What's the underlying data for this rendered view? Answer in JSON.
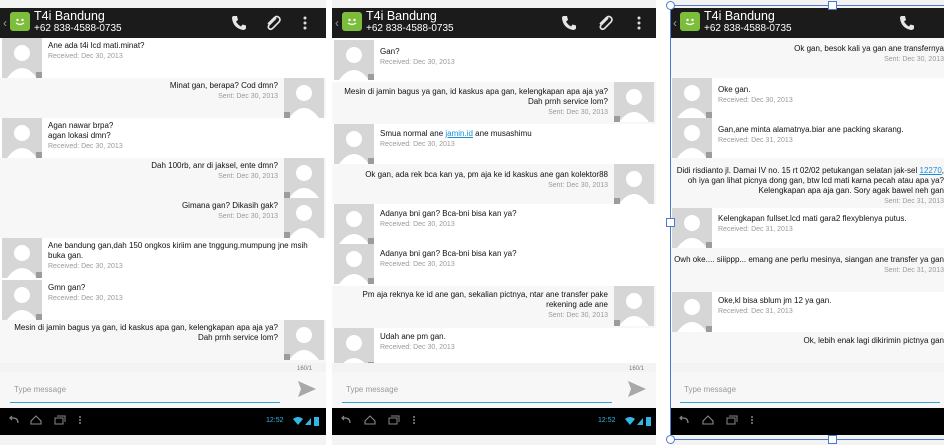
{
  "screens": [
    {
      "contact_name": "T4i Bandung",
      "contact_number": "+62 838-4588-0735",
      "counter": "160/1",
      "compose_placeholder": "Type message",
      "clock": "12:52",
      "messages": [
        {
          "dir": "in",
          "text": "Ane ada t4i lcd mati.minat?",
          "meta": "Received: Dec 30, 2013"
        },
        {
          "dir": "out",
          "text": "Minat gan, berapa? Cod dmn?",
          "meta": "Sent: Dec 30, 2013"
        },
        {
          "dir": "in",
          "text": "Agan nawar brpa?\nagan lokasi dmn?",
          "meta": "Received: Dec 30, 2013"
        },
        {
          "dir": "out",
          "text": "Dah 100rb, anr di jaksel, ente dmn?",
          "meta": "Sent: Dec 30, 2013"
        },
        {
          "dir": "out",
          "text": "Gimana gan? Dikasih gak?",
          "meta": "Sent: Dec 30, 2013"
        },
        {
          "dir": "in",
          "text": "Ane bandung gan,dah 150 ongkos kiriim ane tnggung.mumpung jne msih buka gan.",
          "meta": "Received: Dec 30, 2013"
        },
        {
          "dir": "in",
          "text": "Gmn gan?",
          "meta": "Received: Dec 30, 2013"
        },
        {
          "dir": "out",
          "text": "Mesin di jamin bagus ya gan, id kaskus apa gan, kelengkapan apa aja ya? Dah prnh service lom?",
          "meta": ""
        }
      ]
    },
    {
      "contact_name": "T4i Bandung",
      "contact_number": "+62 838-4588-0735",
      "counter": "160/1",
      "compose_placeholder": "Type message",
      "clock": "12:52",
      "messages": [
        {
          "dir": "in",
          "text": "Gan?",
          "meta": "Received: Dec 30, 2013"
        },
        {
          "dir": "out",
          "text": "Mesin di jamin bagus ya gan, id kaskus apa gan, kelengkapan apa aja ya? Dah prnh service lom?",
          "meta": "Sent: Dec 30, 2013"
        },
        {
          "dir": "in",
          "text": "Smua normal ane ",
          "link": "jamin.id",
          "text_after": " ane musashimu",
          "meta": "Received: Dec 30, 2013"
        },
        {
          "dir": "out",
          "text": "Ok gan, ada rek bca kan ya, pm aja ke id kaskus ane gan kolektor88",
          "meta": "Sent: Dec 30, 2013"
        },
        {
          "dir": "in",
          "text": "Adanya bni gan? Bca-bni bisa kan ya?",
          "meta": "Received: Dec 30, 2013"
        },
        {
          "dir": "in",
          "text": "Adanya bni gan? Bca-bni bisa kan ya?",
          "meta": "Received: Dec 30, 2013"
        },
        {
          "dir": "out",
          "text": "Pm aja reknya ke id ane gan, sekalian pictnya, ntar ane transfer pake rekening ade ane",
          "meta": "Sent: Dec 30, 2013"
        },
        {
          "dir": "in",
          "text": "Udah ane pm gan.",
          "meta": "Received: Dec 30, 2013"
        }
      ]
    },
    {
      "contact_name": "T4i Bandung",
      "contact_number": "+62 838-4588-0735",
      "counter": "",
      "compose_placeholder": "Type message",
      "clock": "",
      "messages": [
        {
          "dir": "out",
          "text": "Ok gan, besok kali ya gan ane transfernya",
          "meta": "Sent: Dec 30, 2013"
        },
        {
          "dir": "in",
          "text": "Oke gan.",
          "meta": "Received: Dec 30, 2013"
        },
        {
          "dir": "in",
          "text": "Gan,ane minta alamatnya.biar ane packing skarang.",
          "meta": "Received: Dec 31, 2013"
        },
        {
          "dir": "out",
          "text": "Didi risdianto jl. Damai IV no. 15 rt 02/02 petukangan selatan jak-sel ",
          "link": "12270",
          "text_after": ", oh iya gan lihat picnya dong gan, btw lcd mati karna pecah atau apa ya? Kelengkapan apa aja gan. Sory agak bawel neh gan",
          "meta": "Sent: Dec 31, 2013"
        },
        {
          "dir": "in",
          "text": "Kelengkapan fullset.lcd mati gara2 flexyblenya putus.",
          "meta": "Received: Dec 31, 2013"
        },
        {
          "dir": "out",
          "text": "Owh oke.... siiippp... emang ane perlu mesinya, siangan ane transfer ya gan",
          "meta": "Sent: Dec 31, 2013"
        },
        {
          "dir": "in",
          "text": "Oke,kl bisa sblum jm 12 ya gan.",
          "meta": "Received: Dec 31, 2013"
        },
        {
          "dir": "out",
          "text": "Ok, lebih enak lagi dikirimin pictnya gan",
          "meta": ""
        }
      ]
    }
  ]
}
